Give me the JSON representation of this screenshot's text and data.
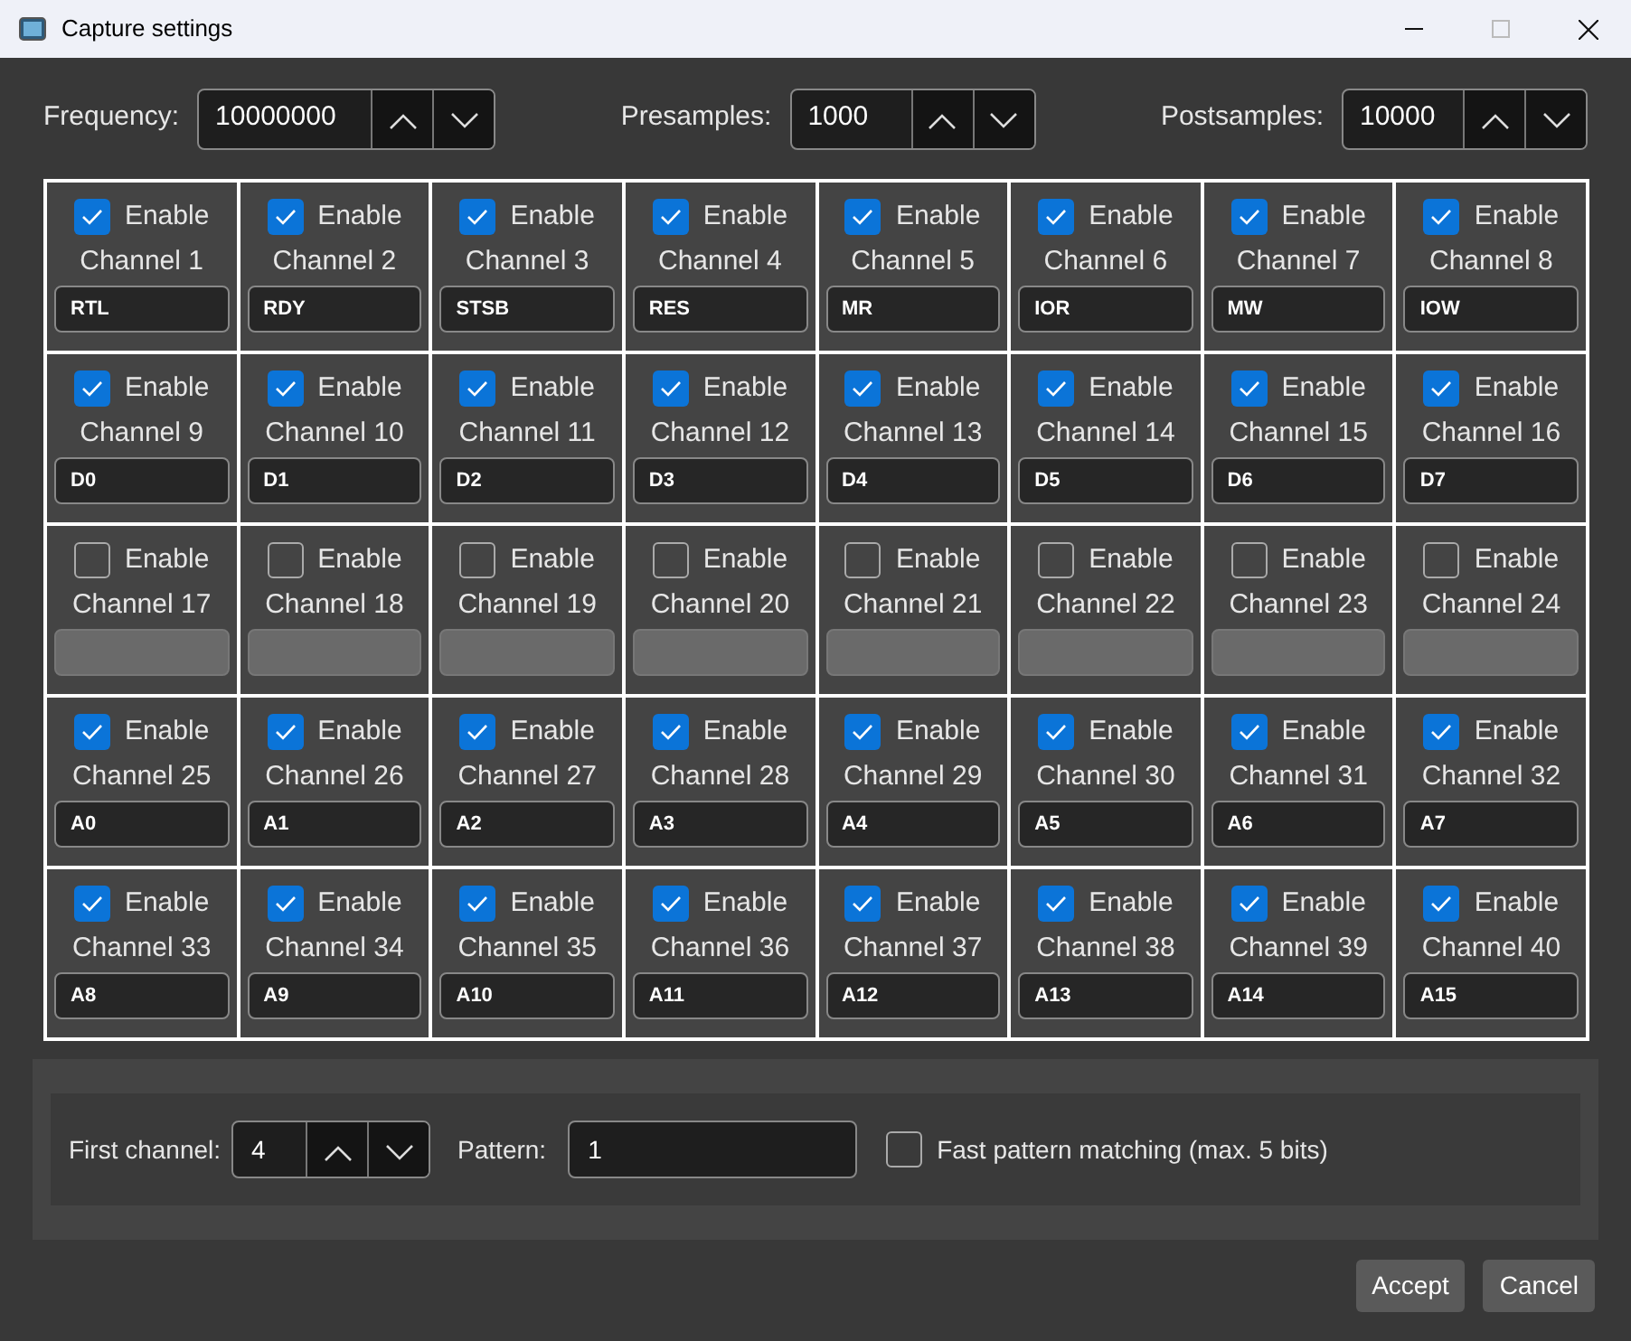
{
  "window": {
    "title": "Capture settings"
  },
  "frequency": {
    "label": "Frequency:",
    "value": "10000000"
  },
  "presamples": {
    "label": "Presamples:",
    "value": "1000"
  },
  "postsamples": {
    "label": "Postsamples:",
    "value": "10000"
  },
  "channels": [
    {
      "enable_label": "Enable",
      "checked": true,
      "label": "Channel 1",
      "name": "RTL"
    },
    {
      "enable_label": "Enable",
      "checked": true,
      "label": "Channel 2",
      "name": "RDY"
    },
    {
      "enable_label": "Enable",
      "checked": true,
      "label": "Channel 3",
      "name": "STSB"
    },
    {
      "enable_label": "Enable",
      "checked": true,
      "label": "Channel 4",
      "name": "RES"
    },
    {
      "enable_label": "Enable",
      "checked": true,
      "label": "Channel 5",
      "name": "MR"
    },
    {
      "enable_label": "Enable",
      "checked": true,
      "label": "Channel 6",
      "name": "IOR"
    },
    {
      "enable_label": "Enable",
      "checked": true,
      "label": "Channel 7",
      "name": "MW"
    },
    {
      "enable_label": "Enable",
      "checked": true,
      "label": "Channel 8",
      "name": "IOW"
    },
    {
      "enable_label": "Enable",
      "checked": true,
      "label": "Channel 9",
      "name": "D0"
    },
    {
      "enable_label": "Enable",
      "checked": true,
      "label": "Channel 10",
      "name": "D1"
    },
    {
      "enable_label": "Enable",
      "checked": true,
      "label": "Channel 11",
      "name": "D2"
    },
    {
      "enable_label": "Enable",
      "checked": true,
      "label": "Channel 12",
      "name": "D3"
    },
    {
      "enable_label": "Enable",
      "checked": true,
      "label": "Channel 13",
      "name": "D4"
    },
    {
      "enable_label": "Enable",
      "checked": true,
      "label": "Channel 14",
      "name": "D5"
    },
    {
      "enable_label": "Enable",
      "checked": true,
      "label": "Channel 15",
      "name": "D6"
    },
    {
      "enable_label": "Enable",
      "checked": true,
      "label": "Channel 16",
      "name": "D7"
    },
    {
      "enable_label": "Enable",
      "checked": false,
      "label": "Channel 17"
    },
    {
      "enable_label": "Enable",
      "checked": false,
      "label": "Channel 18"
    },
    {
      "enable_label": "Enable",
      "checked": false,
      "label": "Channel 19"
    },
    {
      "enable_label": "Enable",
      "checked": false,
      "label": "Channel 20"
    },
    {
      "enable_label": "Enable",
      "checked": false,
      "label": "Channel 21"
    },
    {
      "enable_label": "Enable",
      "checked": false,
      "label": "Channel 22"
    },
    {
      "enable_label": "Enable",
      "checked": false,
      "label": "Channel 23"
    },
    {
      "enable_label": "Enable",
      "checked": false,
      "label": "Channel 24"
    },
    {
      "enable_label": "Enable",
      "checked": true,
      "label": "Channel 25",
      "name": "A0"
    },
    {
      "enable_label": "Enable",
      "checked": true,
      "label": "Channel 26",
      "name": "A1"
    },
    {
      "enable_label": "Enable",
      "checked": true,
      "label": "Channel 27",
      "name": "A2"
    },
    {
      "enable_label": "Enable",
      "checked": true,
      "label": "Channel 28",
      "name": "A3"
    },
    {
      "enable_label": "Enable",
      "checked": true,
      "label": "Channel 29",
      "name": "A4"
    },
    {
      "enable_label": "Enable",
      "checked": true,
      "label": "Channel 30",
      "name": "A5"
    },
    {
      "enable_label": "Enable",
      "checked": true,
      "label": "Channel 31",
      "name": "A6"
    },
    {
      "enable_label": "Enable",
      "checked": true,
      "label": "Channel 32",
      "name": "A7"
    },
    {
      "enable_label": "Enable",
      "checked": true,
      "label": "Channel 33",
      "name": "A8"
    },
    {
      "enable_label": "Enable",
      "checked": true,
      "label": "Channel 34",
      "name": "A9"
    },
    {
      "enable_label": "Enable",
      "checked": true,
      "label": "Channel 35",
      "name": "A10"
    },
    {
      "enable_label": "Enable",
      "checked": true,
      "label": "Channel 36",
      "name": "A11"
    },
    {
      "enable_label": "Enable",
      "checked": true,
      "label": "Channel 37",
      "name": "A12"
    },
    {
      "enable_label": "Enable",
      "checked": true,
      "label": "Channel 38",
      "name": "A13"
    },
    {
      "enable_label": "Enable",
      "checked": true,
      "label": "Channel 39",
      "name": "A14"
    },
    {
      "enable_label": "Enable",
      "checked": true,
      "label": "Channel 40",
      "name": "A15"
    }
  ],
  "trigger": {
    "first_channel": {
      "label": "First channel:",
      "value": "4"
    },
    "pattern": {
      "label": "Pattern:",
      "value": "1"
    },
    "fast_matching": {
      "label": "Fast pattern matching (max. 5 bits)",
      "checked": false
    }
  },
  "buttons": [
    "Accept",
    "Cancel"
  ]
}
